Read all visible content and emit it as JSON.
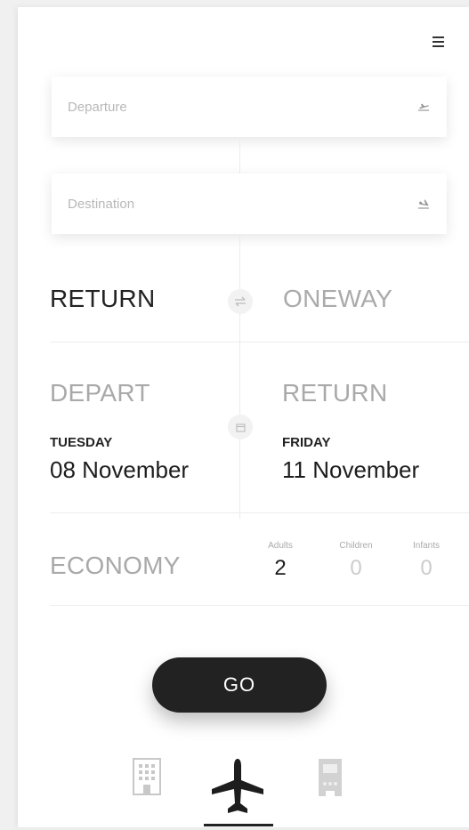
{
  "search": {
    "departure_placeholder": "Departure",
    "destination_placeholder": "Destination"
  },
  "trip_type": {
    "return_label": "RETURN",
    "oneway_label": "ONEWAY",
    "selected": "RETURN"
  },
  "dates": {
    "depart": {
      "label": "DEPART",
      "day": "TUESDAY",
      "date": "08 November"
    },
    "return": {
      "label": "RETURN",
      "day": "FRIDAY",
      "date": "11 November"
    }
  },
  "cabin": {
    "class_label": "ECONOMY"
  },
  "passengers": {
    "adults": {
      "label": "Adults",
      "count": "2"
    },
    "children": {
      "label": "Children",
      "count": "0"
    },
    "infants": {
      "label": "Infants",
      "count": "0"
    }
  },
  "actions": {
    "go_label": "GO"
  },
  "tabs": [
    {
      "icon": "hotel-icon",
      "active": false
    },
    {
      "icon": "airplane-icon",
      "active": true
    },
    {
      "icon": "train-icon",
      "active": false
    }
  ],
  "colors": {
    "primary": "#222222",
    "muted": "#a9a9a9",
    "background": "#ffffff"
  }
}
